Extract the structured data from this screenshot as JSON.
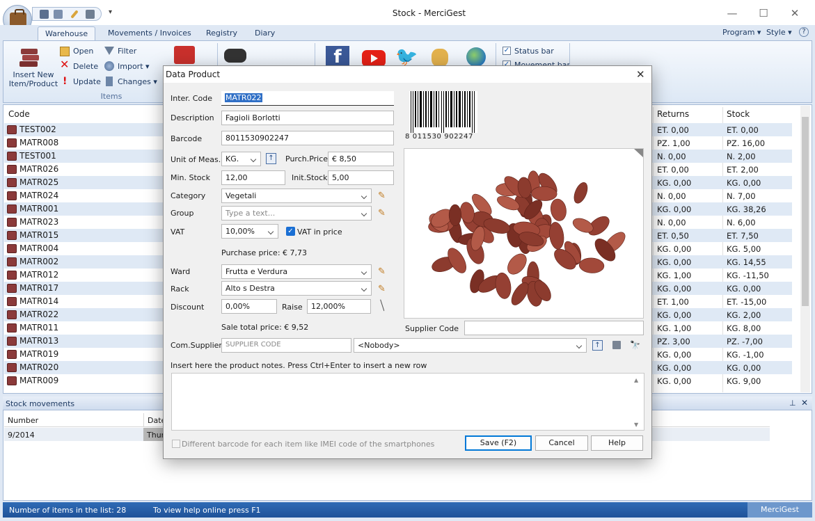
{
  "window": {
    "title": "Stock - MerciGest"
  },
  "tabs": [
    "Warehouse",
    "Movements / Invoices",
    "Registry",
    "Diary"
  ],
  "right_menu": {
    "program": "Program",
    "style": "Style"
  },
  "ribbon": {
    "insert_new": "Insert New Item/Product",
    "insert_line1": "Insert New",
    "insert_line2": "Item/Product",
    "open": "Open",
    "delete": "Delete",
    "update": "Update",
    "filter": "Filter",
    "import": "Import",
    "changes": "Changes",
    "items_group": "Items",
    "status_bar": "Status bar",
    "movement_bar": "Movement bar"
  },
  "list": {
    "headers": {
      "code": "Code",
      "returns": "Returns",
      "stock": "Stock"
    },
    "rows": [
      {
        "code": "TEST002",
        "returns": "ET. 0,00",
        "stock": "ET. 0,00"
      },
      {
        "code": "MATR008",
        "returns": "PZ. 1,00",
        "stock": "PZ. 16,00"
      },
      {
        "code": "TEST001",
        "returns": "N. 0,00",
        "stock": "N. 2,00"
      },
      {
        "code": "MATR026",
        "returns": "ET. 0,00",
        "stock": "ET. 2,00"
      },
      {
        "code": "MATR025",
        "returns": "KG. 0,00",
        "stock": "KG. 0,00"
      },
      {
        "code": "MATR024",
        "returns": "N. 0,00",
        "stock": "N. 7,00"
      },
      {
        "code": "MATR001",
        "returns": "KG. 0,00",
        "stock": "KG. 38,26"
      },
      {
        "code": "MATR023",
        "returns": "N. 0,00",
        "stock": "N. 6,00"
      },
      {
        "code": "MATR015",
        "returns": "ET. 0,50",
        "stock": "ET. 7,50"
      },
      {
        "code": "MATR004",
        "returns": "KG. 0,00",
        "stock": "KG. 5,00"
      },
      {
        "code": "MATR002",
        "returns": "KG. 0,00",
        "stock": "KG. 14,55"
      },
      {
        "code": "MATR012",
        "returns": "KG. 1,00",
        "stock": "KG. -11,50"
      },
      {
        "code": "MATR017",
        "returns": "KG. 0,00",
        "stock": "KG. 0,00"
      },
      {
        "code": "MATR014",
        "returns": "ET. 1,00",
        "stock": "ET. -15,00"
      },
      {
        "code": "MATR022",
        "returns": "KG. 0,00",
        "stock": "KG. 2,00"
      },
      {
        "code": "MATR011",
        "returns": "KG. 1,00",
        "stock": "KG. 8,00"
      },
      {
        "code": "MATR013",
        "returns": "PZ. 3,00",
        "stock": "PZ. -7,00"
      },
      {
        "code": "MATR019",
        "returns": "KG. 0,00",
        "stock": "KG. -1,00"
      },
      {
        "code": "MATR020",
        "returns": "KG. 0,00",
        "stock": "KG. 0,00"
      },
      {
        "code": "MATR009",
        "returns": "KG. 0,00",
        "stock": "KG. 9,00"
      }
    ]
  },
  "movements": {
    "title": "Stock movements",
    "headers": {
      "number": "Number",
      "date": "Date"
    },
    "row": {
      "number": "9/2014",
      "date": "Thur"
    }
  },
  "status": {
    "items": "Number of items in the list: 28",
    "help": "To view help online press F1",
    "brand": "MerciGest"
  },
  "dialog": {
    "title": "Data Product",
    "inter_code_label": "Inter. Code",
    "inter_code": "MATR022",
    "description_label": "Description",
    "description": "Fagioli Borlotti",
    "barcode_label": "Barcode",
    "barcode": "8011530902247",
    "barcode_digits": "8 011530 902247",
    "unit_label": "Unit of Meas.",
    "unit": "KG.",
    "purch_price_label": "Purch.Price",
    "purch_price": "€ 8,50",
    "min_stock_label": "Min. Stock",
    "min_stock": "12,00",
    "init_stock_label": "Init.Stock",
    "init_stock": "5,00",
    "category_label": "Category",
    "category": "Vegetali",
    "group_label": "Group",
    "group_placeholder": "Type a text...",
    "vat_label": "VAT",
    "vat": "10,00%",
    "vat_in_price": "VAT in price",
    "purchase_price_text": "Purchase price: € 7,73",
    "ward_label": "Ward",
    "ward": "Frutta e Verdura",
    "rack_label": "Rack",
    "rack": "Alto s Destra",
    "discount_label": "Discount",
    "discount": "0,00%",
    "raise_label": "Raise",
    "raise": "12,000%",
    "sale_total_text": "Sale total price: € 9,52",
    "supplier_code_label": "Supplier Code",
    "supplier_code": "",
    "com_supplier_label": "Com.Supplier",
    "com_supplier_placeholder": "SUPPLIER CODE",
    "com_supplier_select": "<Nobody>",
    "notes_hint": "Insert here the product notes. Press Ctrl+Enter to insert a new row",
    "notes": "",
    "diff_barcode": "Different barcode for each item like IMEI code of the smartphones",
    "save": "Save (F2)",
    "cancel": "Cancel",
    "help": "Help"
  }
}
